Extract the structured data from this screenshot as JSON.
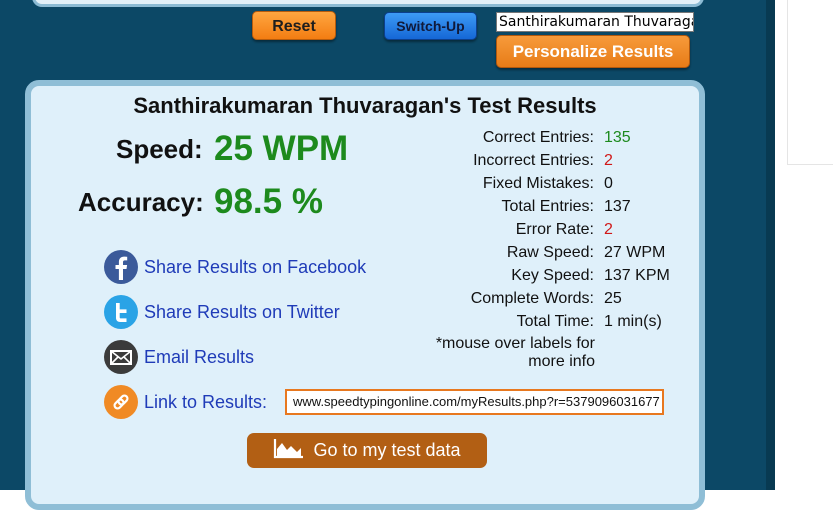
{
  "controls": {
    "reset_label": "Reset",
    "switch_label": "Switch-Up",
    "name_value": "Santhirakumaran Thuvaragan",
    "personalize_label": "Personalize Results"
  },
  "results": {
    "title": "Santhirakumaran Thuvaragan's Test Results",
    "speed_label": "Speed:",
    "speed_value": "25 WPM",
    "accuracy_label": "Accuracy:",
    "accuracy_value": "98.5 %"
  },
  "stats": [
    {
      "label": "Correct Entries:",
      "value": "135",
      "color": "#1d8a1d"
    },
    {
      "label": "Incorrect Entries:",
      "value": "2",
      "color": "#d01818"
    },
    {
      "label": "Fixed Mistakes:",
      "value": "0",
      "color": "#111111"
    },
    {
      "label": "Total Entries:",
      "value": "137",
      "color": "#111111"
    },
    {
      "label": "Error Rate:",
      "value": "2",
      "color": "#d01818"
    },
    {
      "label": "Raw Speed:",
      "value": "27 WPM",
      "color": "#111111"
    },
    {
      "label": "Key Speed:",
      "value": "137 KPM",
      "color": "#111111"
    },
    {
      "label": "Complete Words:",
      "value": "25",
      "color": "#111111"
    },
    {
      "label": "Total Time:",
      "value": "1 min(s)",
      "color": "#111111"
    }
  ],
  "note": {
    "line1": "*mouse over labels for",
    "line2": "more info"
  },
  "share": {
    "facebook": "Share Results on Facebook",
    "twitter": "Share Results on Twitter",
    "email": "Email Results",
    "link_label": "Link to Results:",
    "link_value": "www.speedtypingonline.com/myResults.php?r=5379096031677"
  },
  "test_data_label": "Go to my test data",
  "icons": {
    "facebook": "facebook-icon",
    "twitter": "twitter-icon",
    "email": "email-icon",
    "link": "link-icon",
    "chart": "chart-icon"
  },
  "colors": {
    "accent_orange": "#f37d12",
    "accent_blue": "#1567d6",
    "good": "#1d8a1d",
    "bad": "#d01818",
    "link": "#1f3bb8"
  }
}
